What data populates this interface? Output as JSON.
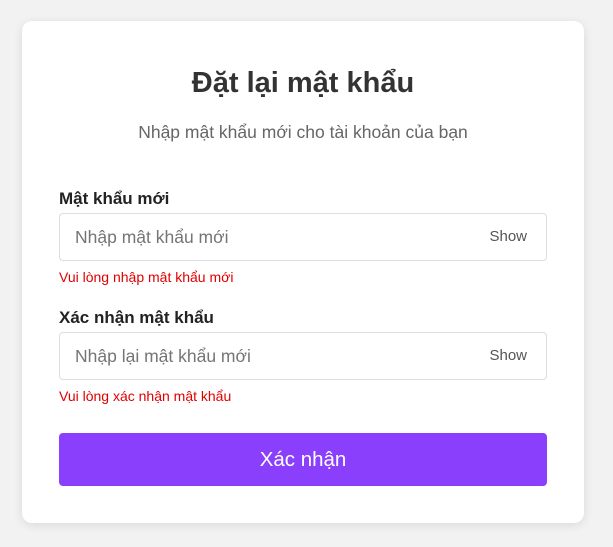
{
  "form": {
    "title": "Đặt lại mật khẩu",
    "subtitle": "Nhập mật khẩu mới cho tài khoản của bạn",
    "new_password": {
      "label": "Mật khẩu mới",
      "placeholder": "Nhập mật khẩu mới",
      "value": "",
      "toggle_label": "Show",
      "error": "Vui lòng nhập mật khẩu mới"
    },
    "confirm_password": {
      "label": "Xác nhận mật khẩu",
      "placeholder": "Nhập lại mật khẩu mới",
      "value": "",
      "toggle_label": "Show",
      "error": "Vui lòng xác nhận mật khẩu"
    },
    "submit_label": "Xác nhận"
  },
  "colors": {
    "page_background": "#f2f2f2",
    "card_background": "#ffffff",
    "primary_button": "#8a3ffc",
    "error_text": "#e00000",
    "title_text": "#333333"
  }
}
